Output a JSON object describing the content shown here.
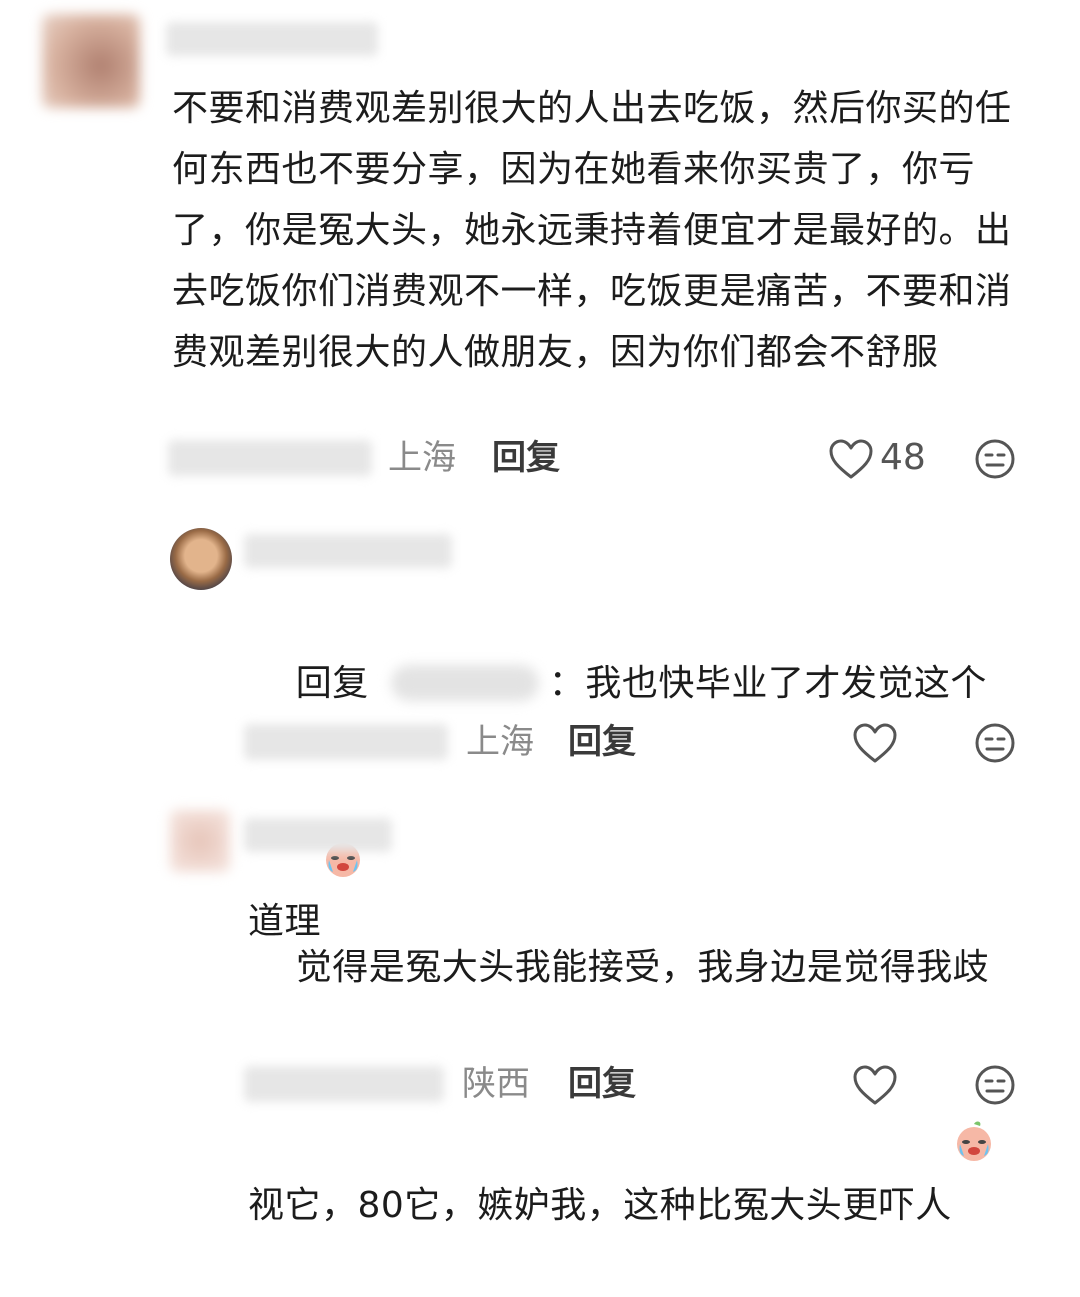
{
  "comments": [
    {
      "text": "不要和消费观差别很大的人出去吃饭，然后你买的任何东西也不要分享，因为在她看来你买贵了，你亏了，你是冤大头，她永远秉持着便宜才是最好的。出去吃饭你们消费观不一样，吃饭更是痛苦，不要和消费观差别很大的人做朋友，因为你们都会不舒服",
      "location": "上海",
      "reply_label": "回复",
      "like_count": "48",
      "icons": {
        "like": "heart-outline-icon",
        "dislike": "meh-face-icon"
      }
    }
  ],
  "replies": [
    {
      "reply_prefix": "回复",
      "separator": "：",
      "text": "我也快毕业了才发觉这个道理",
      "emoji": "crying-peach-emoji",
      "location": "上海",
      "reply_label": "回复",
      "icons": {
        "like": "heart-outline-icon",
        "dislike": "meh-face-icon"
      }
    },
    {
      "text": "觉得是冤大头我能接受，我身边是觉得我歧视它，80它，嫉妒我，这种比冤大头更吓人",
      "emoji": "crying-peach-emoji",
      "location": "陕西",
      "reply_label": "回复",
      "icons": {
        "like": "heart-outline-icon",
        "dislike": "meh-face-icon"
      }
    }
  ],
  "colors": {
    "text": "#1c1c1c",
    "meta": "#8a8a8a",
    "icon": "#555555",
    "background": "#ffffff"
  }
}
